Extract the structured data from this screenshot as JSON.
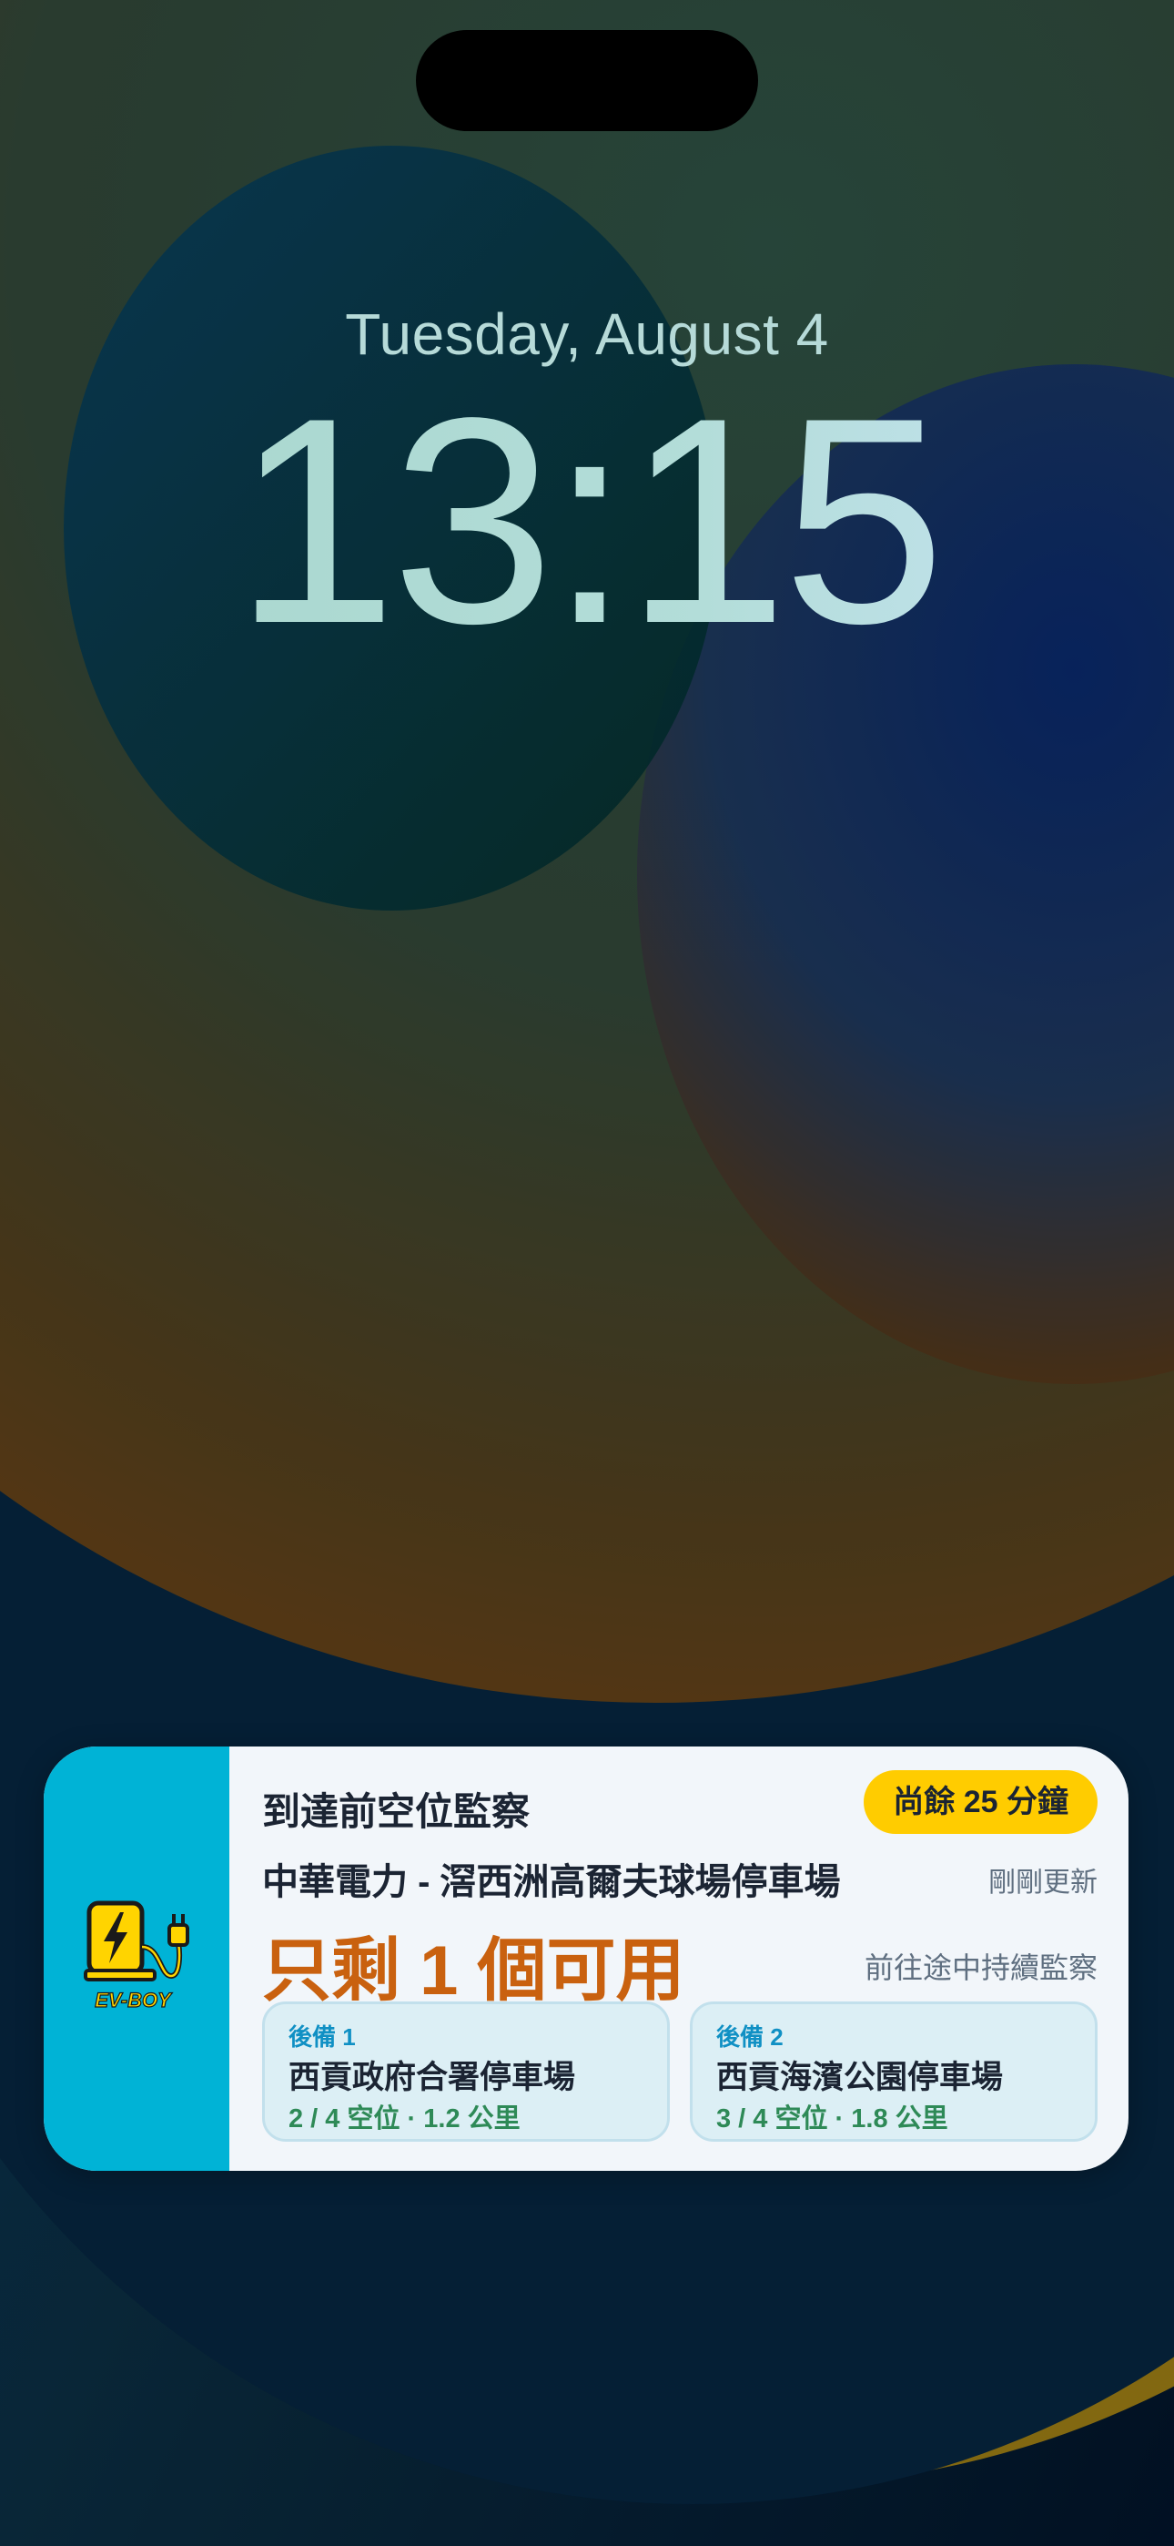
{
  "lock_screen": {
    "date": "Tuesday, August 4",
    "time": "13:15"
  },
  "live_activity": {
    "app_name": "EV-BOY",
    "title": "到達前空位監察",
    "countdown": "尚餘 25 分鐘",
    "station": "中華電力 - 滘西洲高爾夫球場停車場",
    "updated": "剛剛更新",
    "availability": "只剩 1 個可用",
    "monitoring": "前往途中持續監察",
    "backups": [
      {
        "tag": "後備 1",
        "name": "西貢政府合署停車場",
        "detail": "2 / 4 空位 · 1.2 公里"
      },
      {
        "tag": "後備 2",
        "name": "西貢海濱公園停車場",
        "detail": "3 / 4 空位 · 1.8 公里"
      }
    ],
    "colors": {
      "side_accent": "#00b3d6",
      "countdown_pill": "#ffcc00",
      "availability": "#c9610f",
      "backup_detail": "#2e8a57",
      "backup_tag": "#1090c4"
    },
    "icon": "ev-charger-plug-icon"
  }
}
